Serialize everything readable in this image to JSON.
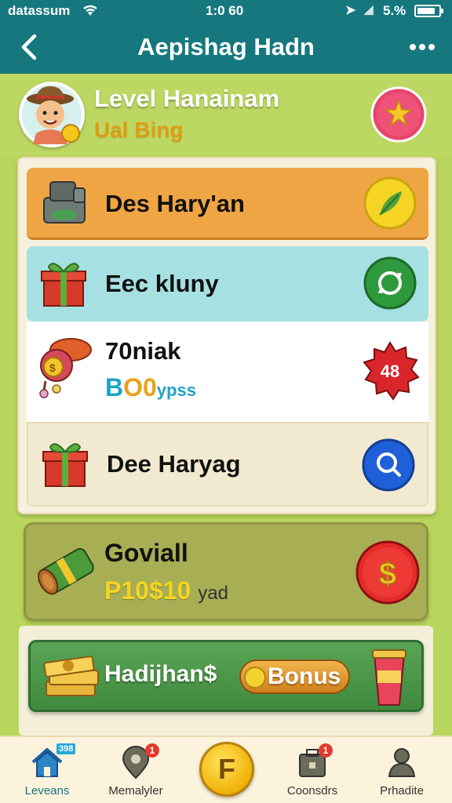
{
  "status_bar": {
    "carrier": "datassum",
    "time": "1:0 60",
    "battery_pct": "5.%",
    "battery_level": 0.85
  },
  "nav": {
    "title": "Aepishag Hadn"
  },
  "header": {
    "level_title": "Level Hanainam",
    "level_sub": "Ual Bing"
  },
  "rows": [
    {
      "label": "Des Hary'an"
    },
    {
      "label": "Eec kluny"
    },
    {
      "label": "70niak",
      "sub_b": "B",
      "sub_s": "O",
      "sub_o": "0",
      "sub_t": "ypss",
      "badge": "48"
    },
    {
      "label": "Dee Haryag"
    }
  ],
  "reward": {
    "title": "Goviall",
    "value": "P10$10",
    "value_suffix": "yad"
  },
  "bonus": {
    "text": "Hadijhan$",
    "badge": "Bonus"
  },
  "tabs": [
    {
      "label": "Leveans",
      "tag": "398"
    },
    {
      "label": "Memalyler",
      "badge": "1"
    },
    {
      "label": "Coonsdrs",
      "badge": "1"
    },
    {
      "label": "Prhadite"
    }
  ],
  "center_coin": "F",
  "colors": {
    "header_teal": "#16787e",
    "background_green": "#b9d65c",
    "row_orange": "#f0a545",
    "row_cyan": "#a6e0e3",
    "reward_olive": "#a7ae54",
    "bonus_green": "#3f8a3f"
  }
}
